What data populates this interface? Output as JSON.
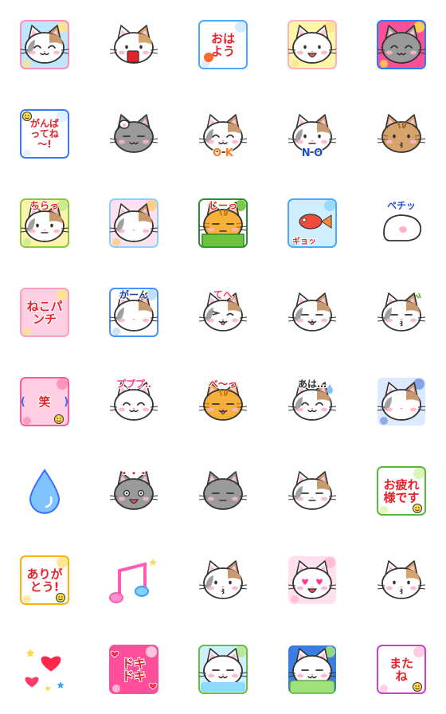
{
  "stickers": [
    {
      "id": 1,
      "name": "cat-hand-to-cheek",
      "bg": "#bfe6ff",
      "bg2": "#ffe38a",
      "frame": "#ff8fb4",
      "cat": "calico",
      "mouth": "smile",
      "eyes": "arc",
      "text": "",
      "textColor": "#ff5a8a",
      "pose": "hand"
    },
    {
      "id": 2,
      "name": "cat-holding-drink",
      "bg": "",
      "bg2": "",
      "frame": "",
      "cat": "tan",
      "mouth": "open",
      "eyes": "dot",
      "text": "",
      "textColor": "#e8202a",
      "pose": "cup"
    },
    {
      "id": 3,
      "name": "ohayou-greeting",
      "bg": "#ffffff",
      "bg2": "#cfe8ff",
      "frame": "#4aa8ff",
      "cat": "none",
      "mouth": "",
      "eyes": "",
      "text": "おはよう",
      "textColor": "#e8202a",
      "pose": "sun"
    },
    {
      "id": 4,
      "name": "cat-surprised-sunburst",
      "bg": "#fff6a8",
      "bg2": "#ffe38a",
      "frame": "#ffb0c8",
      "cat": "white",
      "mouth": "open",
      "eyes": "dot",
      "text": "",
      "textColor": "#ff5a8a",
      "pose": "cheeks"
    },
    {
      "id": 5,
      "name": "gray-cat-stars",
      "bg": "#ff4f9a",
      "bg2": "#ffd84a",
      "frame": "#2b7bff",
      "cat": "gray",
      "mouth": "smile",
      "eyes": "arc",
      "text": "",
      "textColor": "#ffffff",
      "pose": "cheeks"
    },
    {
      "id": 6,
      "name": "ganbatte-ne",
      "bg": "#ffffff",
      "bg2": "#d9f0ff",
      "frame": "#3b77ff",
      "cat": "none",
      "mouth": "",
      "eyes": "",
      "text": "がんばってね〜!",
      "textColor": "#e8202a",
      "pose": "smiley"
    },
    {
      "id": 7,
      "name": "gray-cat-rubbing-head",
      "bg": "",
      "bg2": "",
      "frame": "",
      "cat": "gray",
      "mouth": "smile",
      "eyes": "line",
      "text": "",
      "textColor": "#333333",
      "pose": "paw"
    },
    {
      "id": 8,
      "name": "cat-ok-sign",
      "bg": "",
      "bg2": "",
      "frame": "",
      "cat": "calico",
      "mouth": "smile",
      "eyes": "arc",
      "text": "O K",
      "textColor": "#ff7a1a",
      "pose": "ok"
    },
    {
      "id": 9,
      "name": "cat-no-sign",
      "bg": "",
      "bg2": "",
      "frame": "",
      "cat": "calico",
      "mouth": "flat",
      "eyes": "dot",
      "text": "N O",
      "textColor": "#1a4fd0",
      "pose": "no"
    },
    {
      "id": 10,
      "name": "tabby-cat-kiss",
      "bg": "",
      "bg2": "",
      "frame": "",
      "cat": "tabby",
      "mouth": "kiss",
      "eyes": "dot",
      "text": "",
      "textColor": "#333333",
      "pose": "side"
    },
    {
      "id": 11,
      "name": "chiraa-peek",
      "bg": "#fff3b0",
      "bg2": "#c7e98f",
      "frame": "#8dc63f",
      "cat": "calico",
      "mouth": "flat",
      "eyes": "dot",
      "text": "ちらっ",
      "textColor": "#e8202a",
      "pose": "peek"
    },
    {
      "id": 12,
      "name": "cat-watching-fish-tank",
      "bg": "#ffe0ee",
      "bg2": "#ffcb7d",
      "frame": "#8ad0ff",
      "cat": "calico",
      "mouth": "",
      "eyes": "",
      "text": "",
      "textColor": "#333333",
      "pose": "back"
    },
    {
      "id": 13,
      "name": "jii-stare",
      "bg": "#ffffff",
      "bg2": "#6fc23c",
      "frame": "#2f8f2f",
      "cat": "orange",
      "mouth": "flat",
      "eyes": "half",
      "text": "じーっ",
      "textColor": "#e8202a",
      "pose": "box"
    },
    {
      "id": 14,
      "name": "goldfish-gyo",
      "bg": "#cfeeff",
      "bg2": "#8fd8ff",
      "frame": "#4aa8ff",
      "cat": "none",
      "mouth": "",
      "eyes": "",
      "text": "ギョッ",
      "textColor": "#e8202a",
      "pose": "fish"
    },
    {
      "id": 15,
      "name": "pechi-paw",
      "bg": "#ffffff",
      "bg2": "#ffffff",
      "frame": "",
      "cat": "paw",
      "mouth": "",
      "eyes": "",
      "text": "ペチッ",
      "textColor": "#2b4fd0",
      "pose": "paw"
    },
    {
      "id": 16,
      "name": "neko-punch",
      "bg": "#ffd0e4",
      "bg2": "#ffe38a",
      "frame": "#ff9ec2",
      "cat": "none",
      "mouth": "",
      "eyes": "",
      "text": "ねこパンチ",
      "textColor": "#e8202a",
      "pose": "burst"
    },
    {
      "id": 17,
      "name": "gaan-shock",
      "bg": "#ffffff",
      "bg2": "#b9dcff",
      "frame": "#4a8fff",
      "cat": "calico",
      "mouth": "",
      "eyes": "",
      "text": "がーん",
      "textColor": "#1a3fa8",
      "pose": "lying"
    },
    {
      "id": 18,
      "name": "tehe-wink",
      "bg": "",
      "bg2": "",
      "frame": "",
      "cat": "calico",
      "mouth": "tongue",
      "eyes": "wink",
      "text": "てへ",
      "textColor": "#ff3a6a",
      "pose": "wink"
    },
    {
      "id": 19,
      "name": "cat-tongue-out",
      "bg": "",
      "bg2": "",
      "frame": "",
      "cat": "calico",
      "mouth": "tongue",
      "eyes": "line",
      "text": "",
      "textColor": "#333333",
      "pose": "cheeks"
    },
    {
      "id": 20,
      "name": "cat-whistling",
      "bg": "",
      "bg2": "",
      "frame": "",
      "cat": "calico",
      "mouth": "kiss",
      "eyes": "line",
      "text": "",
      "textColor": "#7ec242",
      "pose": "whistle"
    },
    {
      "id": 21,
      "name": "warai-laugh",
      "bg": "#ffd0e4",
      "bg2": "#ff8fb4",
      "frame": "#ff5a9a",
      "cat": "none",
      "mouth": "",
      "eyes": "",
      "text": "笑",
      "textColor": "#e8202a",
      "pose": "laugh"
    },
    {
      "id": 22,
      "name": "pupupu-giggle",
      "bg": "",
      "bg2": "",
      "frame": "",
      "cat": "white",
      "mouth": "smile",
      "eyes": "arc",
      "text": "プププ‥",
      "textColor": "#ff3a8a",
      "pose": "giggle"
    },
    {
      "id": 23,
      "name": "bee-tabby",
      "bg": "",
      "bg2": "",
      "frame": "",
      "cat": "orange",
      "mouth": "tongue",
      "eyes": "line",
      "text": "べ〜っ",
      "textColor": "#e8202a",
      "pose": "tongue"
    },
    {
      "id": 24,
      "name": "aha-sweat",
      "bg": "",
      "bg2": "",
      "frame": "",
      "cat": "calico",
      "mouth": "smile",
      "eyes": "arc",
      "text": "あは…",
      "textColor": "#333333",
      "pose": "sweat"
    },
    {
      "id": 25,
      "name": "cat-gloomy-back",
      "bg": "#dce9ff",
      "bg2": "#7a9ce0",
      "frame": "",
      "cat": "calico",
      "mouth": "",
      "eyes": "",
      "text": "",
      "textColor": "#333333",
      "pose": "back"
    },
    {
      "id": 26,
      "name": "water-drop",
      "bg": "",
      "bg2": "",
      "frame": "",
      "cat": "none",
      "mouth": "",
      "eyes": "",
      "text": "",
      "textColor": "#3a8fff",
      "pose": "drop"
    },
    {
      "id": 27,
      "name": "gray-cat-dots-shock",
      "bg": "",
      "bg2": "",
      "frame": "",
      "cat": "gray",
      "mouth": "open",
      "eyes": "big",
      "text": "・・・",
      "textColor": "#e8202a",
      "pose": "shock"
    },
    {
      "id": 28,
      "name": "gray-cat-pouting",
      "bg": "",
      "bg2": "",
      "frame": "",
      "cat": "gray",
      "mouth": "flat",
      "eyes": "half",
      "text": "",
      "textColor": "#333333",
      "pose": "chin"
    },
    {
      "id": 29,
      "name": "cat-sleeping",
      "bg": "",
      "bg2": "",
      "frame": "",
      "cat": "calico",
      "mouth": "flat",
      "eyes": "line",
      "text": "",
      "textColor": "#e8202a",
      "pose": "sleep"
    },
    {
      "id": 30,
      "name": "otsukaresama",
      "bg": "#ffffff",
      "bg2": "#d8f5a8",
      "frame": "#56b83c",
      "cat": "none",
      "mouth": "",
      "eyes": "",
      "text": "お疲れ様です",
      "textColor": "#e8202a",
      "pose": "smiley"
    },
    {
      "id": 31,
      "name": "arigatou",
      "bg": "#ffffff",
      "bg2": "#ffe38a",
      "frame": "#ffb000",
      "cat": "none",
      "mouth": "",
      "eyes": "",
      "text": "ありがとう!",
      "textColor": "#e8202a",
      "pose": "catface"
    },
    {
      "id": 32,
      "name": "music-notes",
      "bg": "",
      "bg2": "",
      "frame": "",
      "cat": "none",
      "mouth": "",
      "eyes": "",
      "text": "",
      "textColor": "#ff5ab4",
      "pose": "notes"
    },
    {
      "id": 33,
      "name": "cat-kiss-face",
      "bg": "",
      "bg2": "",
      "frame": "",
      "cat": "calico",
      "mouth": "kiss",
      "eyes": "dot",
      "text": "",
      "textColor": "#333333",
      "pose": "side"
    },
    {
      "id": 34,
      "name": "cat-heart-eyes",
      "bg": "#ffe0ee",
      "bg2": "#ffb8d2",
      "frame": "",
      "cat": "white",
      "mouth": "open",
      "eyes": "heart",
      "text": "",
      "textColor": "#ff3a8a",
      "pose": "cheeks"
    },
    {
      "id": 35,
      "name": "cat-pucker-kiss",
      "bg": "",
      "bg2": "",
      "frame": "",
      "cat": "tan",
      "mouth": "kiss",
      "eyes": "dot",
      "text": "",
      "textColor": "#333333",
      "pose": "side"
    },
    {
      "id": 36,
      "name": "hearts-stars",
      "bg": "",
      "bg2": "",
      "frame": "",
      "cat": "none",
      "mouth": "",
      "eyes": "",
      "text": "",
      "textColor": "#ff2a4a",
      "pose": "hearts"
    },
    {
      "id": 37,
      "name": "doki-doki",
      "bg": "#ff4f9a",
      "bg2": "#ffd0e4",
      "frame": "#ff4f9a",
      "cat": "none",
      "mouth": "",
      "eyes": "",
      "text": "ドキドキ",
      "textColor": "#e8202a",
      "pose": "doki"
    },
    {
      "id": 38,
      "name": "cat-in-bath",
      "bg": "#cdefff",
      "bg2": "#b6e88f",
      "frame": "#68c13a",
      "cat": "white",
      "mouth": "smile",
      "eyes": "line",
      "text": "",
      "textColor": "#333333",
      "pose": "bath"
    },
    {
      "id": 39,
      "name": "cat-under-blanket",
      "bg": "#3a7fe0",
      "bg2": "#9fe27a",
      "frame": "",
      "cat": "white",
      "mouth": "smile",
      "eyes": "line",
      "text": "",
      "textColor": "#333333",
      "pose": "blanket"
    },
    {
      "id": 40,
      "name": "matane-bye",
      "bg": "#ffffff",
      "bg2": "#ffc6e0",
      "frame": "#d23ad2",
      "cat": "none",
      "mouth": "",
      "eyes": "",
      "text": "またね",
      "textColor": "#e8202a",
      "pose": "catface"
    }
  ]
}
